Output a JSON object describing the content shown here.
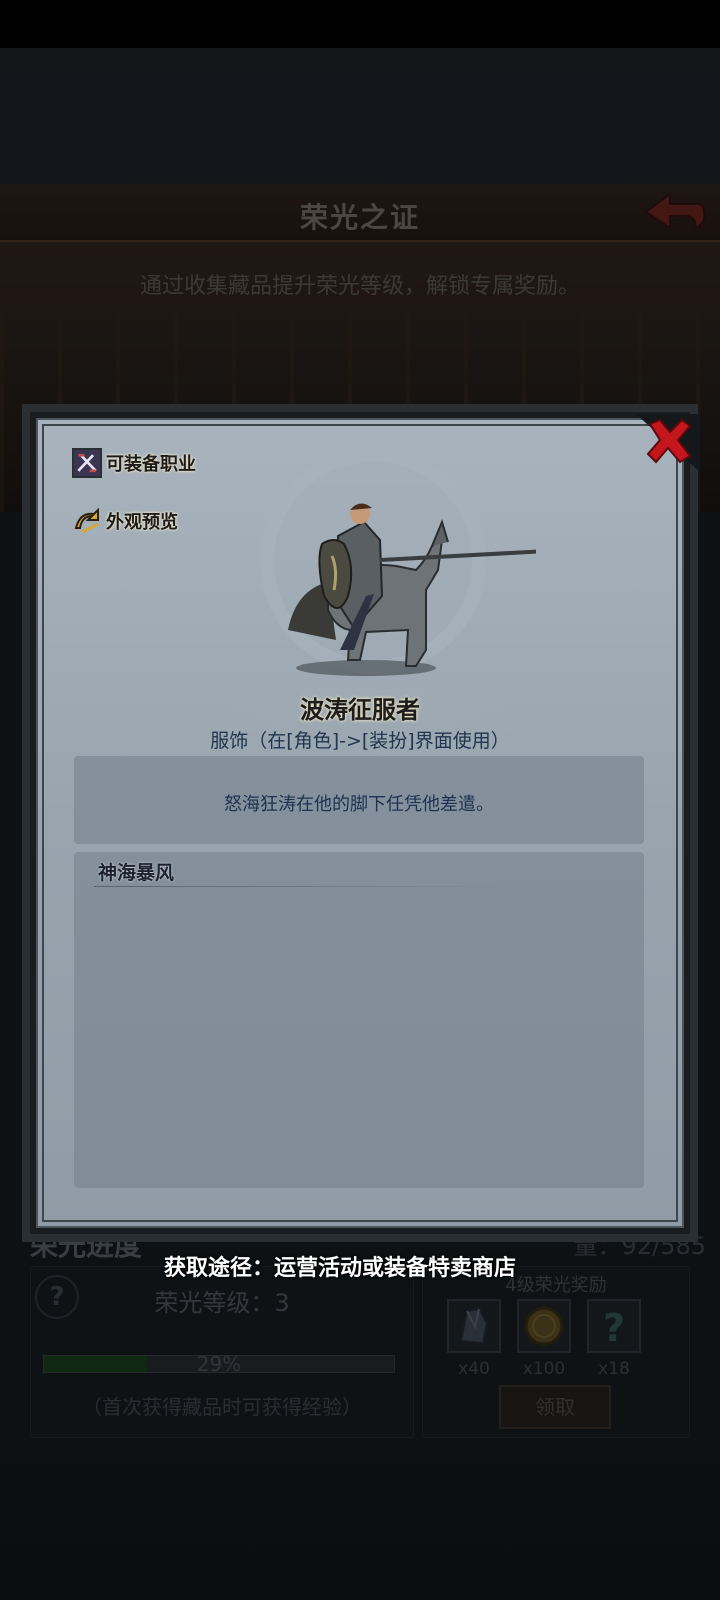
{
  "screen": {
    "title": "荣光之证",
    "description": "通过收集藏品提升荣光等级，解锁专属奖励。",
    "progress_title": "荣光进度",
    "progress_count": "量：92/585",
    "level_label": "荣光等级：3",
    "exp_percent": 0.29,
    "exp_text": "29%",
    "exp_note": "（首次获得藏品时可获得经验）",
    "reward_title": "4级荣光奖励",
    "rewards": [
      {
        "icon": "crystal-icon",
        "count": "x40"
      },
      {
        "icon": "gold-coin-icon",
        "count": "x100"
      },
      {
        "icon": "mystery-question-icon",
        "count": "x18"
      }
    ],
    "claim_label": "领取"
  },
  "dialog": {
    "equip_class_label": "可装备职业",
    "appearance_preview_label": "外观预览",
    "item_name": "波涛征服者",
    "item_type": "服饰（在[角色]->[装扮]界面使用）",
    "item_desc": "怒海狂涛在他的脚下任凭他差遣。",
    "set_title": "神海暴风",
    "source_text": "获取途径：运营活动或装备特卖商店"
  },
  "colors": {
    "accent_red": "#c4161c",
    "title_gold": "#e8e0c0",
    "exp_bar": "#1c4a22"
  }
}
